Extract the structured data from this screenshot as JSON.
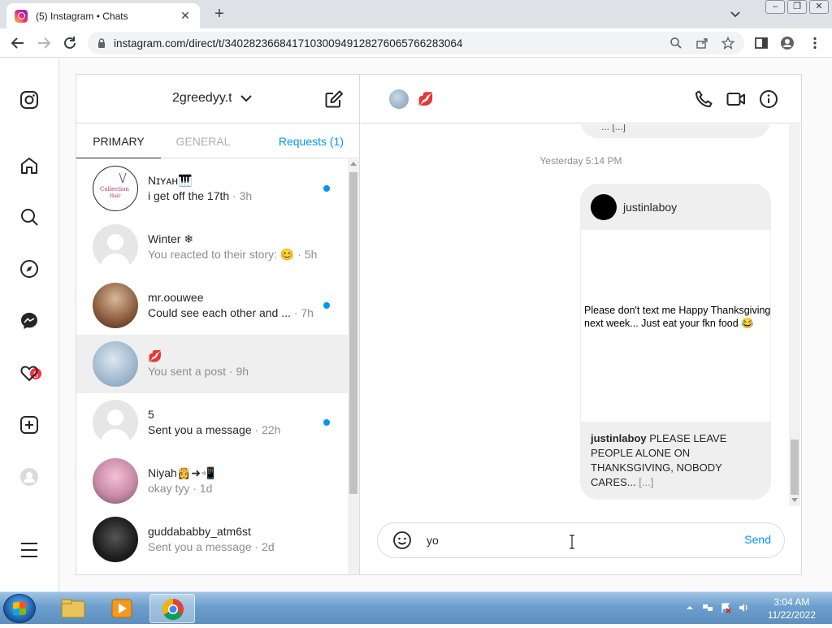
{
  "browser": {
    "tab_title": "(5) Instagram • Chats",
    "tab_close": "✕",
    "new_tab": "+",
    "url": "instagram.com/direct/t/340282366841710300949128276065766283064"
  },
  "instagram": {
    "username": "2greedyy.t",
    "tabs": {
      "primary": "PRIMARY",
      "general": "GENERAL",
      "requests": "Requests (1)"
    },
    "notification_badge": "5",
    "chats": [
      {
        "name": "Nɪʏᴀʜ🎹",
        "message": "i get off the 17th",
        "time": "· 3h",
        "unread": true
      },
      {
        "name": "Winter ❄",
        "message": "You reacted to their story: 😊",
        "time": "· 5h",
        "unread": false
      },
      {
        "name": "mr.oouwee",
        "message": "Could see each other and ...",
        "time": "· 7h",
        "unread": true
      },
      {
        "name": "💋",
        "message": "You sent a post",
        "time": "· 9h",
        "unread": false
      },
      {
        "name": "5",
        "message": "Sent you a message",
        "time": "· 22h",
        "unread": true
      },
      {
        "name": "Niyah👸➜📲",
        "message": "okay tyy",
        "time": "· 1d",
        "unread": false
      },
      {
        "name": "guddababby_atm6st",
        "message": "Sent you a message",
        "time": "· 2d",
        "unread": false
      }
    ],
    "thread": {
      "contact_name": "💋",
      "previous_snippet": "... [...]",
      "timestamp": "Yesterday 5:14 PM",
      "post": {
        "username": "justinlaboy",
        "text": "Please don't text me Happy Thanksgiving next week... Just eat your fkn food 😂",
        "caption_user": "justinlaboy",
        "caption_text": " PLEASE LEAVE PEOPLE ALONE ON THANKSGIVING, NOBODY CARES... ",
        "caption_more": "[...]"
      },
      "composer_value": "yo",
      "send_label": "Send"
    }
  },
  "taskbar": {
    "time": "3:04 AM",
    "date": "11/22/2022"
  }
}
